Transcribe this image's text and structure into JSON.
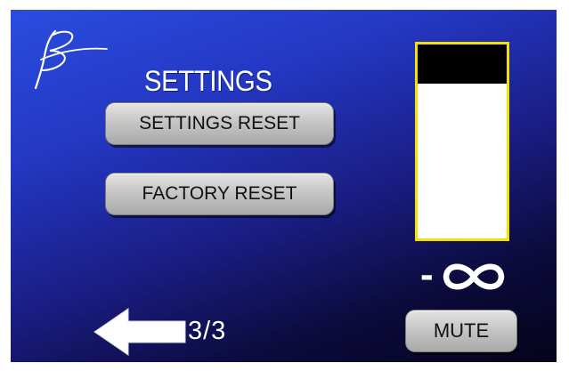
{
  "settings": {
    "title": "SETTINGS",
    "settings_reset_label": "SETTINGS RESET",
    "factory_reset_label": "FACTORY RESET"
  },
  "meter": {
    "level_minus": "-",
    "level_icon": "infinity-icon",
    "filled_fraction": 0.2,
    "border_color": "#f4e100"
  },
  "controls": {
    "mute_label": "MUTE"
  },
  "navigation": {
    "back_icon": "left-arrow-icon",
    "page_indicator": "3/3"
  },
  "branding": {
    "logo_icon": "signature-logo"
  },
  "colors": {
    "background_top": "#2a4dde",
    "background_bottom": "#05041c",
    "button_face": "#c6c6c6"
  }
}
